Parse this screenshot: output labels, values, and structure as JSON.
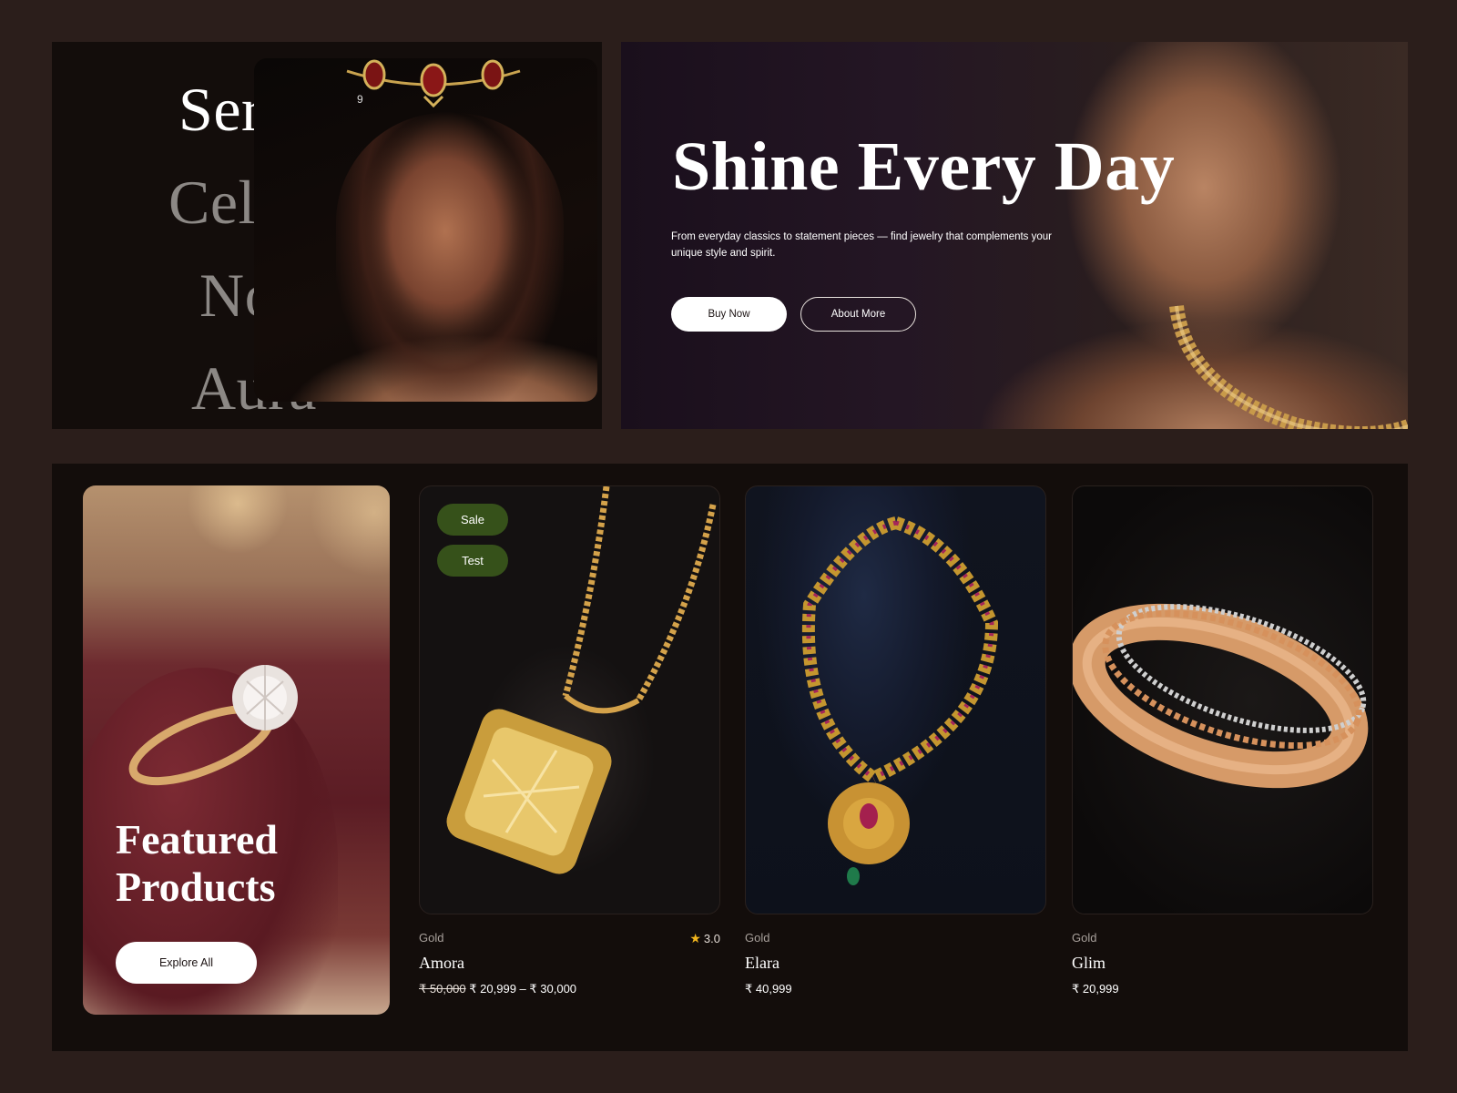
{
  "word_panel": {
    "words": [
      "Serene",
      "Cel",
      "No",
      "Aura"
    ],
    "index": "9"
  },
  "hero": {
    "title": "Shine Every Day",
    "subtitle": "From everyday classics to statement pieces — find jewelry that complements your unique style and spirit.",
    "buy_label": "Buy Now",
    "about_label": "About More"
  },
  "featured": {
    "title": "Featured Products",
    "explore_label": "Explore All"
  },
  "products": [
    {
      "category": "Gold",
      "name": "Amora",
      "price_old": "₹ 50,000",
      "price": "₹ 20,999 – ₹ 30,000",
      "rating": "3.0",
      "badges": [
        "Sale",
        "Test"
      ]
    },
    {
      "category": "Gold",
      "name": "Elara",
      "price": "₹ 40,999"
    },
    {
      "category": "Gold",
      "name": "Glim",
      "price": "₹ 20,999"
    }
  ],
  "colors": {
    "background": "#2b1e1b",
    "panel": "#130d0b",
    "badge": "#36511a",
    "star": "#f2b51d"
  },
  "icons": [
    "star-icon"
  ]
}
